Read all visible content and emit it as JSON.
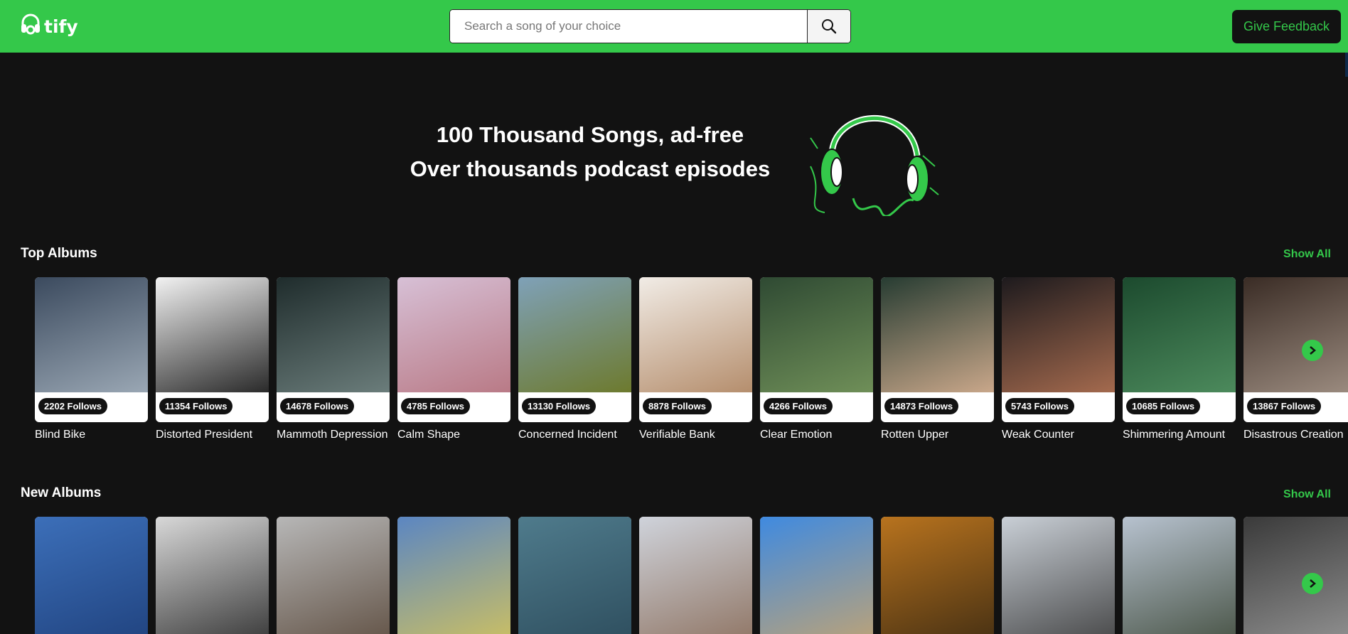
{
  "nav": {
    "logo_text": "tify",
    "search_placeholder": "Search a song of your choice",
    "feedback_label": "Give Feedback"
  },
  "hero": {
    "line1": "100 Thousand Songs, ad-free",
    "line2": "Over thousands podcast episodes"
  },
  "top_albums": {
    "title": "Top Albums",
    "show_all": "Show All",
    "items": [
      {
        "title": "Blind Bike",
        "follows": "2202 Follows",
        "c1": "#3b4a5e",
        "c2": "#9aa7b4"
      },
      {
        "title": "Distorted President",
        "follows": "11354 Follows",
        "c1": "#f2f2f2",
        "c2": "#2a2a2a"
      },
      {
        "title": "Mammoth Depression",
        "follows": "14678 Follows",
        "c1": "#1f2c2c",
        "c2": "#6b7d7b"
      },
      {
        "title": "Calm Shape",
        "follows": "4785 Follows",
        "c1": "#d7c0d6",
        "c2": "#b97a86"
      },
      {
        "title": "Concerned Incident",
        "follows": "13130 Follows",
        "c1": "#7fa1b8",
        "c2": "#6d7a2e"
      },
      {
        "title": "Verifiable Bank",
        "follows": "8878 Follows",
        "c1": "#f1ece6",
        "c2": "#b58e6d"
      },
      {
        "title": "Clear Emotion",
        "follows": "4266 Follows",
        "c1": "#2f4a33",
        "c2": "#6f8f58"
      },
      {
        "title": "Rotten Upper",
        "follows": "14873 Follows",
        "c1": "#273c32",
        "c2": "#c9a78a"
      },
      {
        "title": "Weak Counter",
        "follows": "5743 Follows",
        "c1": "#1d1a1d",
        "c2": "#a46a4e"
      },
      {
        "title": "Shimmering Amount",
        "follows": "10685 Follows",
        "c1": "#1c4a2e",
        "c2": "#4c8a5c"
      },
      {
        "title": "Disastrous Creation",
        "follows": "13867 Follows",
        "c1": "#3a2c25",
        "c2": "#9c8c80"
      }
    ]
  },
  "new_albums": {
    "title": "New Albums",
    "show_all": "Show All",
    "items": [
      {
        "c1": "#3c6fb9",
        "c2": "#1e3f7a"
      },
      {
        "c1": "#d8d8d8",
        "c2": "#2a2a2a"
      },
      {
        "c1": "#b7b7b7",
        "c2": "#5b4a3c"
      },
      {
        "c1": "#5b86c2",
        "c2": "#d6c55a"
      },
      {
        "c1": "#4f7b8c",
        "c2": "#2b4a5a"
      },
      {
        "c1": "#cfd3db",
        "c2": "#8a6d5a"
      },
      {
        "c1": "#3f8ae0",
        "c2": "#c8a56e"
      },
      {
        "c1": "#b8731e",
        "c2": "#3c2a12"
      },
      {
        "c1": "#c9cfd6",
        "c2": "#3b3b3b"
      },
      {
        "c1": "#b7c2cf",
        "c2": "#3f4a3a"
      },
      {
        "c1": "#3a3a3a",
        "c2": "#9a9a9a"
      }
    ]
  },
  "colors": {
    "brand_green": "#34c84a",
    "background": "#121212"
  },
  "icons": {
    "search": "search-icon",
    "next": "chevron-right-icon",
    "logo": "headphones-logo-icon"
  }
}
